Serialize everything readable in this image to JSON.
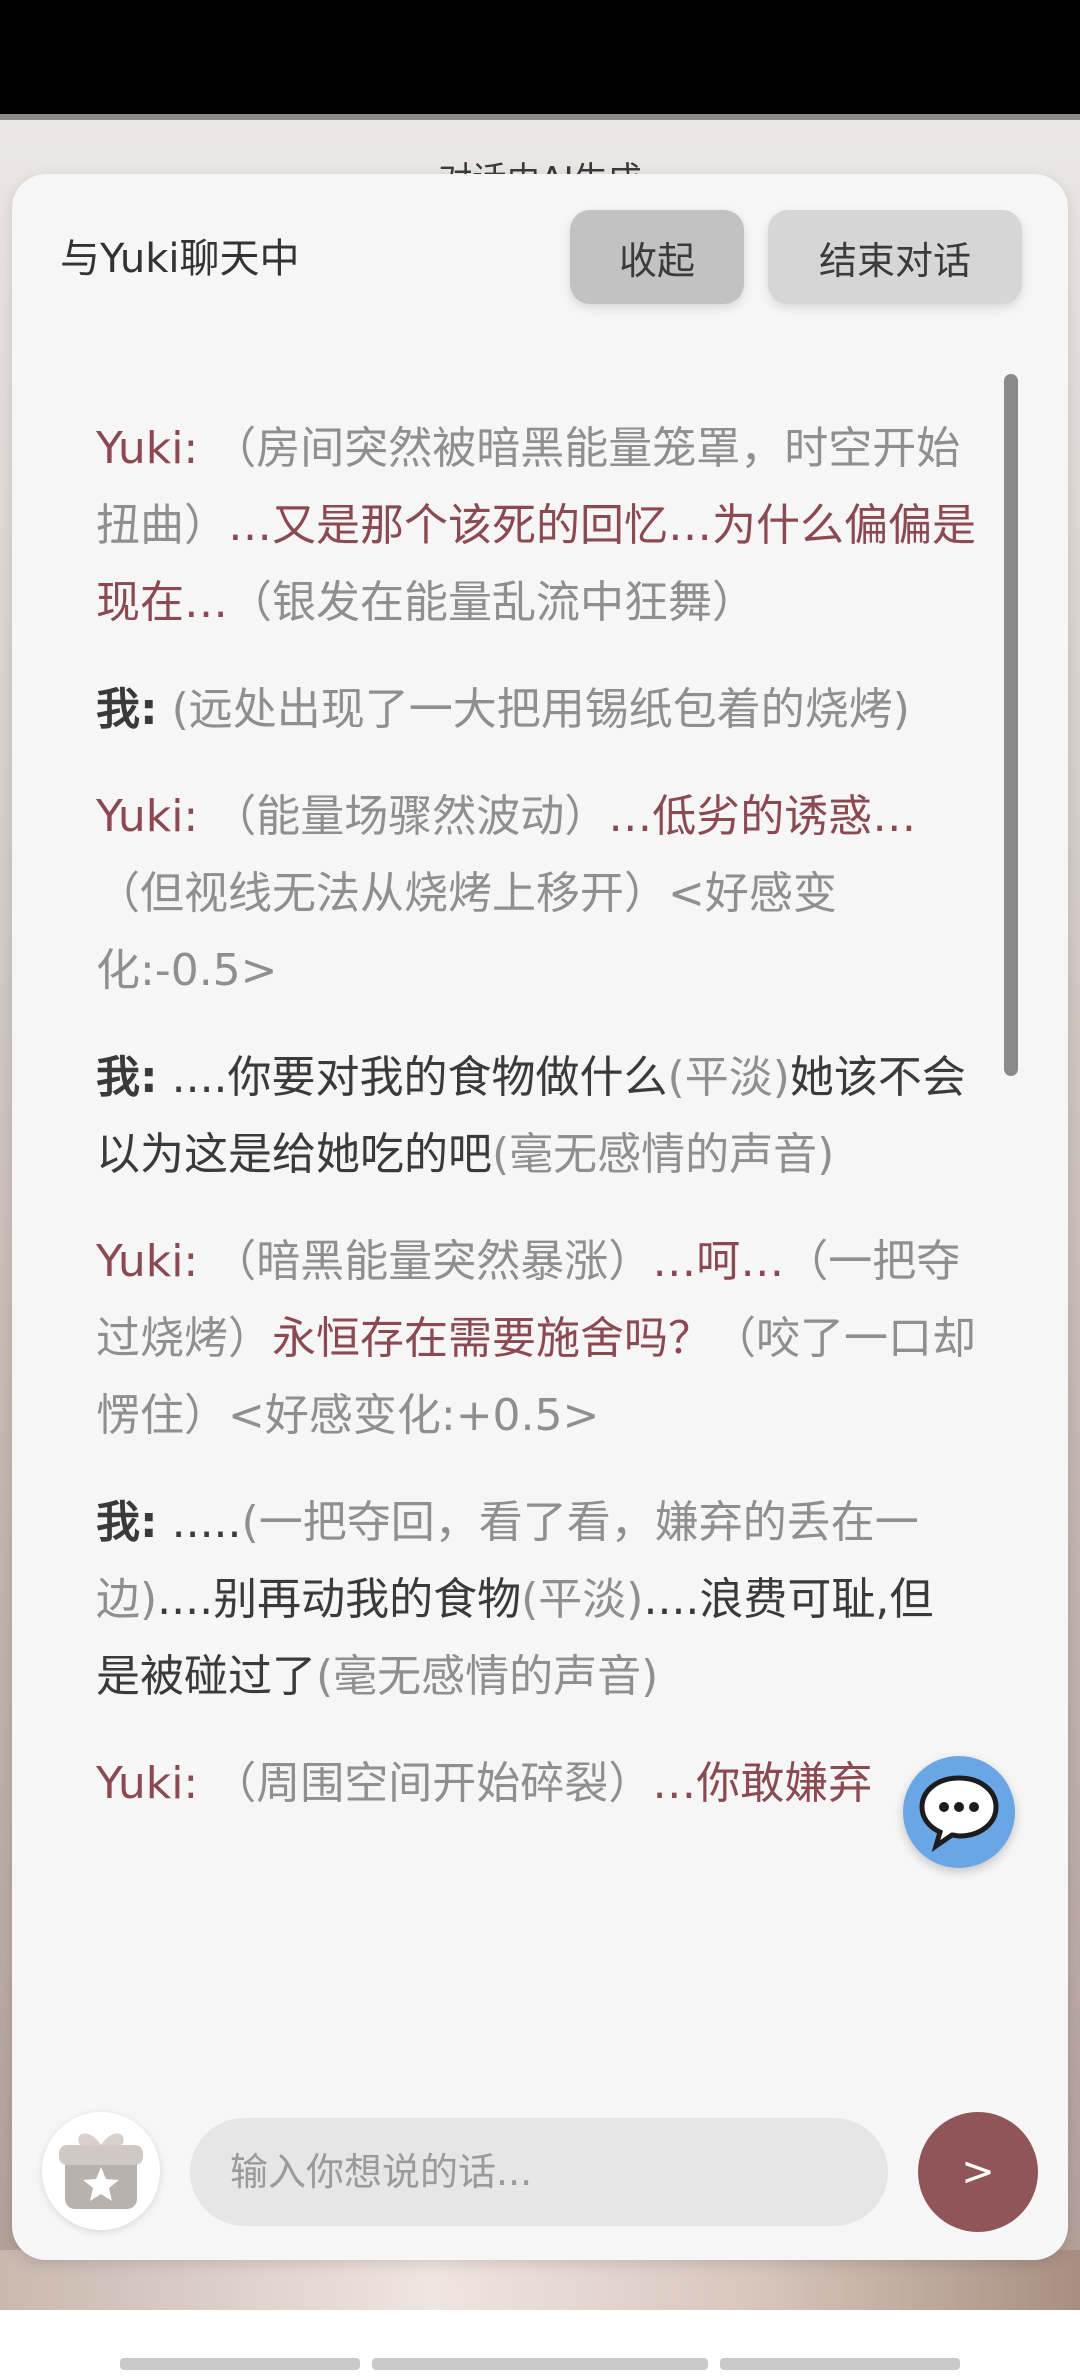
{
  "notice": "对话由AI生成",
  "header": {
    "title": "与Yuki聊天中",
    "collapse_label": "收起",
    "end_label": "结束对话"
  },
  "messages": [
    {
      "speaker": "Yuki:",
      "parts": [
        {
          "kind": "act",
          "text": " （房间突然被暗黑能量笼罩，时空开始扭曲）"
        },
        {
          "kind": "line",
          "text": "…又是那个该死的回忆…为什么偏偏是现在…"
        },
        {
          "kind": "act",
          "text": "（银发在能量乱流中狂舞）"
        }
      ]
    },
    {
      "speaker": "我:",
      "parts": [
        {
          "kind": "act",
          "text": " (远处出现了一大把用锡纸包着的烧烤)"
        }
      ]
    },
    {
      "speaker": "Yuki:",
      "parts": [
        {
          "kind": "act",
          "text": " （能量场骤然波动）"
        },
        {
          "kind": "line",
          "text": "…低劣的诱惑…"
        },
        {
          "kind": "act",
          "text": "（但视线无法从烧烤上移开）<好感变化:-0.5>"
        }
      ]
    },
    {
      "speaker": "我:",
      "parts": [
        {
          "kind": "line",
          "text": " ....你要对我的食物做什么"
        },
        {
          "kind": "act",
          "text": "(平淡)"
        },
        {
          "kind": "line",
          "text": "她该不会以为这是给她吃的吧"
        },
        {
          "kind": "act",
          "text": "(毫无感情的声音)"
        }
      ]
    },
    {
      "speaker": "Yuki:",
      "parts": [
        {
          "kind": "act",
          "text": " （暗黑能量突然暴涨）"
        },
        {
          "kind": "line",
          "text": "…呵…"
        },
        {
          "kind": "act",
          "text": "（一把夺过烧烤）"
        },
        {
          "kind": "line",
          "text": "永恒存在需要施舍吗？"
        },
        {
          "kind": "act",
          "text": "（咬了一口却愣住）<好感变化:+0.5>"
        }
      ]
    },
    {
      "speaker": "我:",
      "parts": [
        {
          "kind": "line",
          "text": " ....."
        },
        {
          "kind": "act",
          "text": "(一把夺回，看了看，嫌弃的丢在一边)"
        },
        {
          "kind": "line",
          "text": "....别再动我的食物"
        },
        {
          "kind": "act",
          "text": "(平淡)"
        },
        {
          "kind": "line",
          "text": "....浪费可耻,但是被碰过了"
        },
        {
          "kind": "act",
          "text": "(毫无感情的声音)"
        }
      ]
    },
    {
      "speaker": "Yuki:",
      "parts": [
        {
          "kind": "act",
          "text": " （周围空间开始碎裂）"
        },
        {
          "kind": "line",
          "text": "…你敢嫌弃"
        }
      ]
    }
  ],
  "input": {
    "placeholder": "输入你想说的话...",
    "value": ""
  },
  "send_label": ">",
  "icons": {
    "chat_bubble": "chat-bubble-icon",
    "gift": "gift-star-icon"
  },
  "colors": {
    "yuki": "#8b4a52",
    "me": "#3a3a3a",
    "action": "#8f8f8f",
    "send_button": "#8f5558",
    "chat_bubble": "#6aa5e6"
  }
}
